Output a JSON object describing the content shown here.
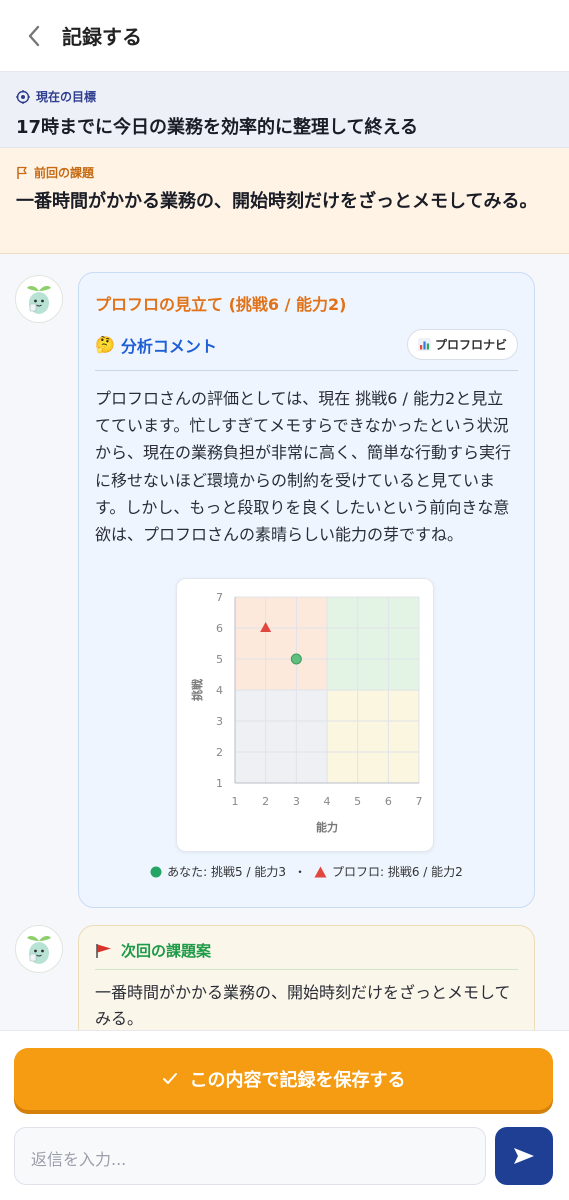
{
  "header": {
    "title": "記録する"
  },
  "goal": {
    "label": "現在の目標",
    "text": "17時までに今日の業務を効率的に整理して終える"
  },
  "previous": {
    "label": "前回の課題",
    "text": "一番時間がかかる業務の、開始時刻だけをざっとメモしてみる。"
  },
  "assessment": {
    "title": "プロフロの見立て (挑戦6 / 能力2)",
    "analysis_label": "分析コメント",
    "analysis_emoji": "🤔",
    "navi_label": "プロフロナビ",
    "body": "プロフロさんの評価としては、現在 挑戦6 / 能力2と見立てています。忙しすぎてメモすらできなかったという状況から、現在の業務負担が非常に高く、簡単な行動すら実行に移せないほど環境からの制約を受けていると見ています。しかし、もっと段取りを良くしたいという前向きな意欲は、プロフロさんの素晴らしい能力の芽ですね。",
    "legend_you": "あなた: 挑戦5 / 能力3",
    "legend_separator": "・",
    "legend_proflo": "プロフロ: 挑戦6 / 能力2"
  },
  "chart_data": {
    "type": "scatter",
    "xlabel": "能力",
    "ylabel": "挑戦",
    "xlim": [
      1,
      7
    ],
    "ylim": [
      1,
      7
    ],
    "xticks": [
      1,
      2,
      3,
      4,
      5,
      6,
      7
    ],
    "yticks": [
      1,
      2,
      3,
      4,
      5,
      6,
      7
    ],
    "grid": true,
    "quadrants": [
      {
        "x": [
          1,
          4
        ],
        "y": [
          4,
          7
        ],
        "color": "#fde9dc"
      },
      {
        "x": [
          4,
          7
        ],
        "y": [
          4,
          7
        ],
        "color": "#e3f4e4"
      },
      {
        "x": [
          1,
          4
        ],
        "y": [
          1,
          4
        ],
        "color": "#eef0f3"
      },
      {
        "x": [
          4,
          7
        ],
        "y": [
          1,
          4
        ],
        "color": "#fbf6df"
      }
    ],
    "points": [
      {
        "series": "あなた",
        "x": 3,
        "y": 5,
        "marker": "circle",
        "color": "#5fbf7f"
      },
      {
        "series": "プロフロ",
        "x": 2,
        "y": 6,
        "marker": "triangle",
        "color": "#e2473f"
      }
    ]
  },
  "next": {
    "title": "次回の課題案",
    "body": "一番時間がかかる業務の、開始時刻だけをざっとメモしてみる。"
  },
  "save_button": {
    "label": "この内容で記録を保存する"
  },
  "reply": {
    "placeholder": "返信を入力..."
  },
  "colors": {
    "accent": "#f59c12",
    "primary": "#1f3f95",
    "analysis": "#1f5fd6",
    "next_title": "#1e9b47"
  }
}
